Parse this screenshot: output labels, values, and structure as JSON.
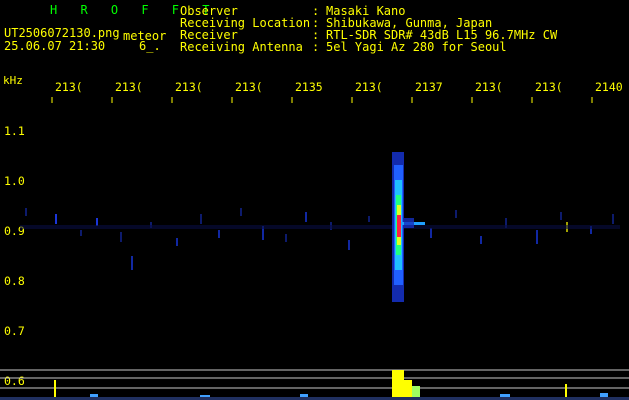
{
  "header": {
    "station": "H R O F F T",
    "filename": "UT2506072130.png",
    "meteor_label": "meteor",
    "datetime": "25.06.07 21:30",
    "amplitude": "6_."
  },
  "info": [
    {
      "label": "Observer",
      "value": "Masaki Kano"
    },
    {
      "label": "Receiving Location",
      "value": "Shibukawa, Gunma, Japan"
    },
    {
      "label": "Receiver",
      "value": "RTL-SDR SDR# 43dB L15 96.7MHz CW"
    },
    {
      "label": "Receiving Antenna",
      "value": "5el Yagi Az 280 for Seoul"
    }
  ],
  "colon": ":",
  "axis": {
    "unit": "kHz",
    "x_ticks": [
      "213(",
      "213(",
      "213(",
      "213(",
      "2135",
      "213(",
      "2137",
      "213(",
      "213(",
      "2140"
    ],
    "y_ticks": [
      "1.1",
      "1.0",
      "0.9",
      "0.8",
      "0.7",
      "0.6"
    ]
  },
  "colors": {
    "text_yellow": "#ffff00",
    "text_green": "#00ff00",
    "background": "#000000",
    "signal_red": "#ff2040",
    "signal_blue": "#1030ff"
  }
}
